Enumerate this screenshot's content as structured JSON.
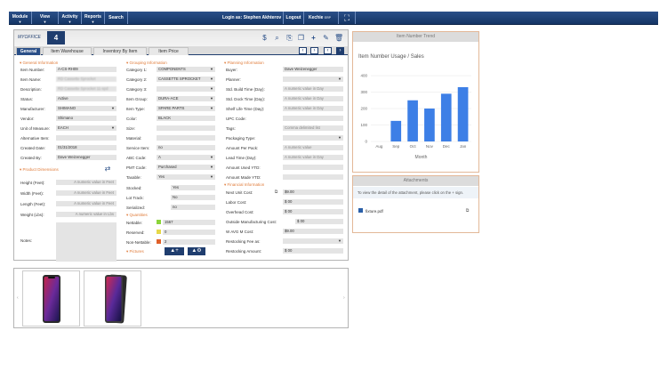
{
  "nav": {
    "items": [
      {
        "label": "Module"
      },
      {
        "label": "View"
      },
      {
        "label": "Activity"
      },
      {
        "label": "Reports"
      },
      {
        "label": "Search"
      }
    ],
    "login": "Login as: Stephen Akhterov",
    "logout": "Logout",
    "company": "Kechie",
    "erp": "ERP"
  },
  "header": {
    "logo_text": "MYOFFICE",
    "logo_box": "4",
    "tabs": [
      {
        "label": "General"
      },
      {
        "label": "Item Warehouse"
      },
      {
        "label": "Inventory By Item"
      },
      {
        "label": "Item Price"
      }
    ]
  },
  "general": {
    "title": "General Information",
    "fields": [
      {
        "label": "Item Number:",
        "value": "A-CS-RH09"
      },
      {
        "label": "Item Name:",
        "value": "RD Cassette Sprocket"
      },
      {
        "label": "Description:",
        "value": "RD Cassette Sprocket 11-spd"
      },
      {
        "label": "Status:",
        "value": "Active"
      },
      {
        "label": "Manufacturer:",
        "value": "SHIMANO"
      },
      {
        "label": "Vendor:",
        "value": "Shimano"
      },
      {
        "label": "Unit of Measure:",
        "value": "EACH"
      },
      {
        "label": "Alternative Item:",
        "value": ""
      },
      {
        "label": "Created Date:",
        "value": "01/31/2018"
      },
      {
        "label": "Created By:",
        "value": "Dave Weizenegger"
      }
    ]
  },
  "dims": {
    "title": "Product Dimensions",
    "fields": [
      {
        "label": "Height (Feet):",
        "value": "A numeric value in Feet"
      },
      {
        "label": "Width (Feet):",
        "value": "A numeric value in Feet"
      },
      {
        "label": "Length (Feet):",
        "value": "A numeric value in Feet"
      },
      {
        "label": "Weight (Lbs):",
        "value": "A numeric value in Lbs"
      }
    ],
    "notes_label": "Notes:"
  },
  "grouping": {
    "title": "Grouping Information",
    "fields": [
      {
        "label": "Category 1:",
        "value": "COMPONENTS"
      },
      {
        "label": "Category 2:",
        "value": "CASSETTE SPROCKET"
      },
      {
        "label": "Category 3:",
        "value": ""
      },
      {
        "label": "Item Group:",
        "value": "DURA-ACE"
      },
      {
        "label": "Item Type:",
        "value": "SPARE PARTS"
      },
      {
        "label": "Color:",
        "value": "BLACK"
      },
      {
        "label": "Size:",
        "value": ""
      },
      {
        "label": "Material:",
        "value": ""
      },
      {
        "label": "Service Item:",
        "value": "no"
      },
      {
        "label": "ABC Code:",
        "value": "A"
      },
      {
        "label": "PMT Code:",
        "value": "Purchased"
      },
      {
        "label": "Taxable:",
        "value": "Yes"
      },
      {
        "label": "Stocked:",
        "value": "Yes"
      },
      {
        "label": "Lot Track:",
        "value": "No"
      },
      {
        "label": "Serialized:",
        "value": "no"
      }
    ]
  },
  "quantities": {
    "title": "Quantities",
    "fields": [
      {
        "label": "Nettable:",
        "value": "1567",
        "color": "#8bd43a"
      },
      {
        "label": "Reserved:",
        "value": "0",
        "color": "#e6d84a"
      },
      {
        "label": "Non-Nettable:",
        "value": "2",
        "color": "#e0602a"
      }
    ]
  },
  "pictures": {
    "title": "Pictures"
  },
  "planning": {
    "title": "Planning Information",
    "fields": [
      {
        "label": "Buyer:",
        "value": "Dave Weizenegger"
      },
      {
        "label": "Planner:",
        "value": ""
      },
      {
        "label": "Std. Build Time (Day):",
        "value": "A numeric value in Day"
      },
      {
        "label": "Std. Dock Time (Day):",
        "value": "A numeric value in Day"
      },
      {
        "label": "Shelf Life Time (Day):",
        "value": "A numeric value in Day"
      },
      {
        "label": "UPC Code:",
        "value": ""
      },
      {
        "label": "Tags:",
        "value": "Comma delimited list"
      },
      {
        "label": "Packaging Type:",
        "value": ""
      },
      {
        "label": "Amount Per Pack:",
        "value": "A numeric value"
      },
      {
        "label": "Lead Time (Day):",
        "value": "A numeric value in Day"
      },
      {
        "label": "Amount Used YTD:",
        "value": ""
      },
      {
        "label": "Amount Made YTD:",
        "value": ""
      }
    ]
  },
  "financial": {
    "title": "Financial Information",
    "fields": [
      {
        "label": "Next Unit Cost:",
        "value": "$9.00"
      },
      {
        "label": "Labor Cost:",
        "value": "$ 00"
      },
      {
        "label": "Overhead Cost:",
        "value": "$ 00"
      },
      {
        "label": "Outside Manufacturing Cost:",
        "value": "$ 00"
      },
      {
        "label": "W AVG M Cost:",
        "value": "$9.00"
      },
      {
        "label": "Restocking Fee as:",
        "value": ""
      },
      {
        "label": "Restocking Amount:",
        "value": "$ 00"
      }
    ]
  },
  "trend": {
    "header": "Item Number Trend"
  },
  "attachments": {
    "header": "Attachments",
    "info": "To view the detail of the attachment, please click on the + sign.",
    "file": "fixture.pdf"
  },
  "chart_data": {
    "type": "bar",
    "title": "Item Number Usage / Sales",
    "categories": [
      "Aug",
      "Sep",
      "Oct",
      "Nov",
      "Dec",
      "Jan"
    ],
    "values": [
      0,
      125,
      250,
      200,
      290,
      330
    ],
    "xlabel": "Month",
    "ylabel": "",
    "ylim": [
      0,
      400
    ],
    "yticks": [
      0,
      100,
      200,
      300,
      400
    ],
    "color": "#3d7fe6",
    "grid": true
  }
}
